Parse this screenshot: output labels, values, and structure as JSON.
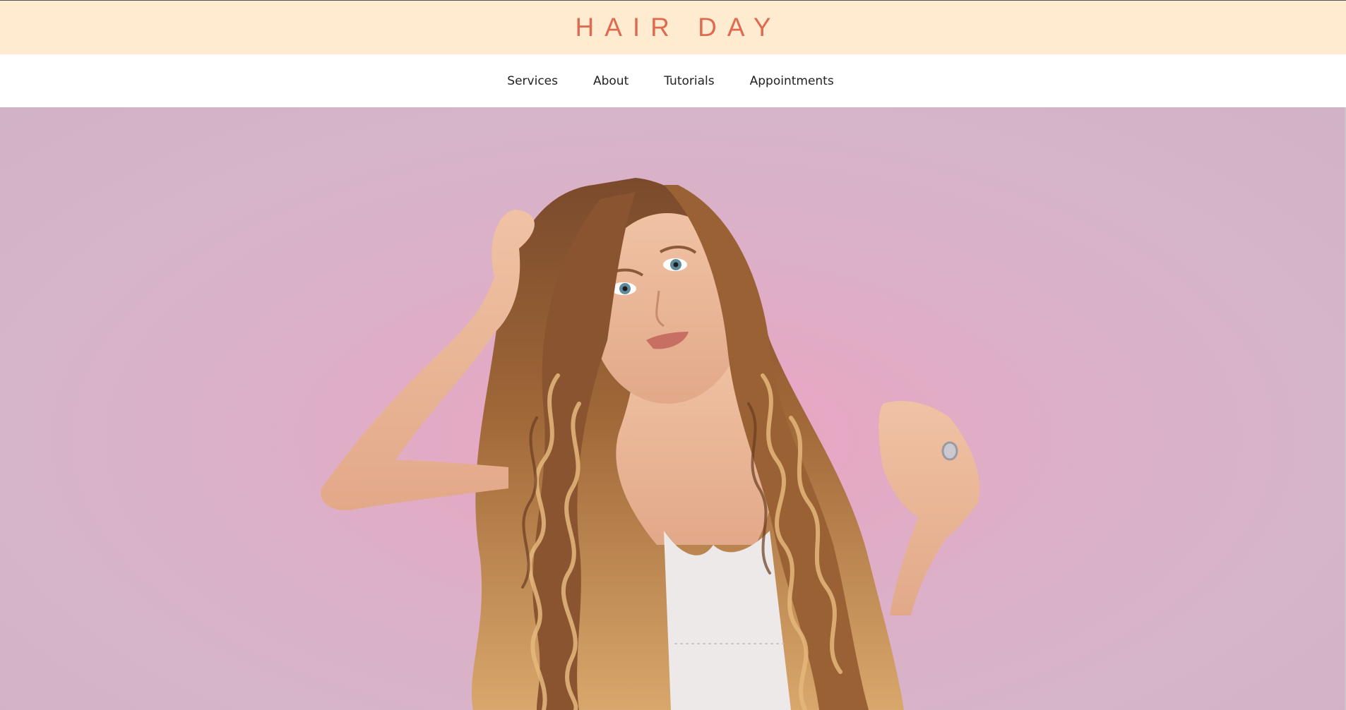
{
  "header": {
    "brand": "HAIR DAY",
    "background_color": "#ffebd0",
    "brand_color": "#e06a50"
  },
  "nav": {
    "items": [
      {
        "label": "Services"
      },
      {
        "label": "About"
      },
      {
        "label": "Tutorials"
      },
      {
        "label": "Appointments"
      }
    ]
  },
  "hero": {
    "image_subject": "portrait of woman with long wavy blonde hair against pink wall",
    "background_color": "#d8b2c8"
  }
}
